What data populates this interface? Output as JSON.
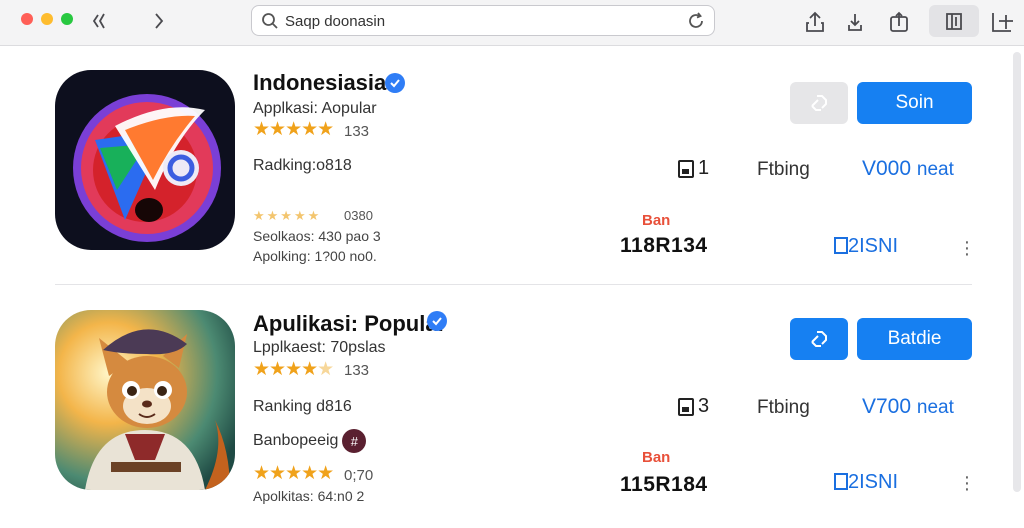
{
  "browser": {
    "url_text": "Saqp doonasin",
    "icons": [
      "back-forward-icon",
      "forward-icon",
      "search-icon",
      "reload-icon",
      "share-icon",
      "download-icon",
      "upload-icon",
      "tabs-icon",
      "new-tab-icon"
    ]
  },
  "apps": [
    {
      "title": "Indonesiasia",
      "subtitle": "Applkasi: Aopular",
      "rating_count": "133",
      "ranking": "Radking:o818",
      "faint_rating": "0380",
      "line_a": "Seolkaos: 430 pao 3",
      "line_b": "Apolking: 1?00 no0.",
      "secondary_btn": "icon",
      "primary_label": "Soin",
      "stat_count": "1",
      "rating_label": "Ftbing",
      "price": "V000",
      "price_unit": "neat",
      "red_tag": "Ban",
      "big_number": "118R134",
      "link_text": "2ISNI"
    },
    {
      "title": "Apulikasi: Popular",
      "subtitle": "Lpplkaest: 70pslas",
      "rating_count": "133",
      "ranking": "Ranking d816",
      "badge_text": "Banbopeeig",
      "star_rating_count": "0;70",
      "line_b": "Apolkitas: 64:n0 2",
      "secondary_btn": "icon",
      "primary_label": "Batdie",
      "stat_count": "3",
      "rating_label": "Ftbing",
      "price": "V700",
      "price_unit": "neat",
      "red_tag": "Ban",
      "big_number": "115R184",
      "link_text": "2ISNI"
    }
  ],
  "colors": {
    "accent": "#1680f2",
    "star": "#f0a21b",
    "red_tag": "#e8503a",
    "link": "#1a6fe0"
  }
}
